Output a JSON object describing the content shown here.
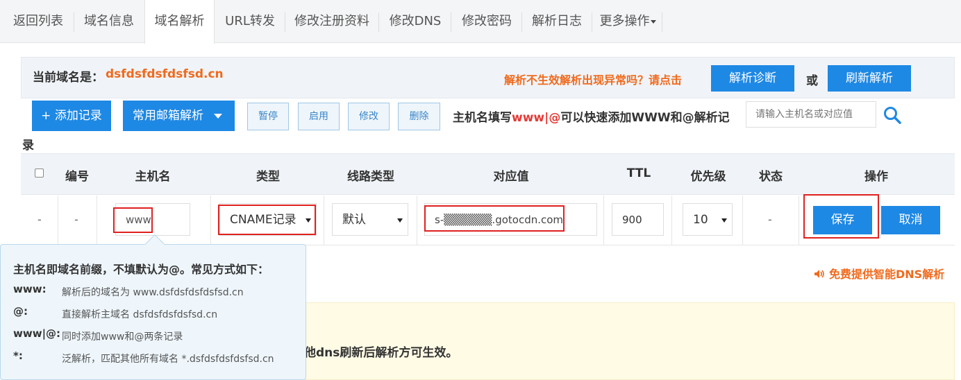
{
  "tabs": [
    {
      "label": "返回列表"
    },
    {
      "label": "域名信息"
    },
    {
      "label": "域名解析",
      "active": true
    },
    {
      "label": "URL转发"
    },
    {
      "label": "修改注册资料"
    },
    {
      "label": "修改DNS"
    },
    {
      "label": "修改密码"
    },
    {
      "label": "解析日志"
    },
    {
      "label": "更多操作"
    }
  ],
  "header": {
    "current_label": "当前域名是：",
    "domain": "dsfdsfdsfdsfsd.cn",
    "warning": "解析不生效解析出现异常吗？请点击",
    "diagnose_btn": "解析诊断",
    "or": "或",
    "refresh_btn": "刷新解析"
  },
  "toolbar": {
    "add_btn": "+ 添加记录",
    "mail_btn": "常用邮箱解析",
    "pause_btn": "暂停",
    "enable_btn": "启用",
    "modify_btn": "修改",
    "delete_btn": "删除",
    "hint_pre": "主机名填写",
    "hint_red": "www|@",
    "hint_post": "可以快速添加WWW和@解析记",
    "hint_wrap": "录",
    "search_placeholder": "请输入主机名或对应值"
  },
  "table": {
    "headers": {
      "no": "编号",
      "host": "主机名",
      "type": "类型",
      "line": "线路类型",
      "value": "对应值",
      "ttl": "TTL",
      "priority": "优先级",
      "status": "状态",
      "action": "操作"
    },
    "row": {
      "dash1": "-",
      "dash2": "-",
      "host": "www",
      "type": "CNAME记录",
      "line": "默认",
      "value": "s-▒▒▒▒▒▒.gotocdn.com",
      "ttl": "900",
      "priority": "10",
      "status": "-",
      "save_btn": "保存",
      "cancel_btn": "取消"
    }
  },
  "tooltip": {
    "title": "主机名即域名前缀，不填默认为@。常见方式如下：",
    "items": [
      {
        "key": "www:",
        "desc": "解析后的域名为 www.dsfdsfdsfdsfsd.cn"
      },
      {
        "key": "@:",
        "desc": "直接解析主域名 dsfdsfdsfdsfsd.cn"
      },
      {
        "key": "www|@:",
        "desc": "同时添加www和@两条记录"
      },
      {
        "key": "*:",
        "desc": "泛解析，匹配其他所有域名 *.dsfdsfdsfdsfsd.cn"
      }
    ]
  },
  "promo": {
    "free_dns": "免费提供智能DNS解析"
  },
  "notice": {
    "text": "他dns刷新后解析方可生效。"
  },
  "colors": {
    "accent_blue": "#1e88e5",
    "orange": "#f06a1d",
    "highlight_red": "#e02020"
  }
}
